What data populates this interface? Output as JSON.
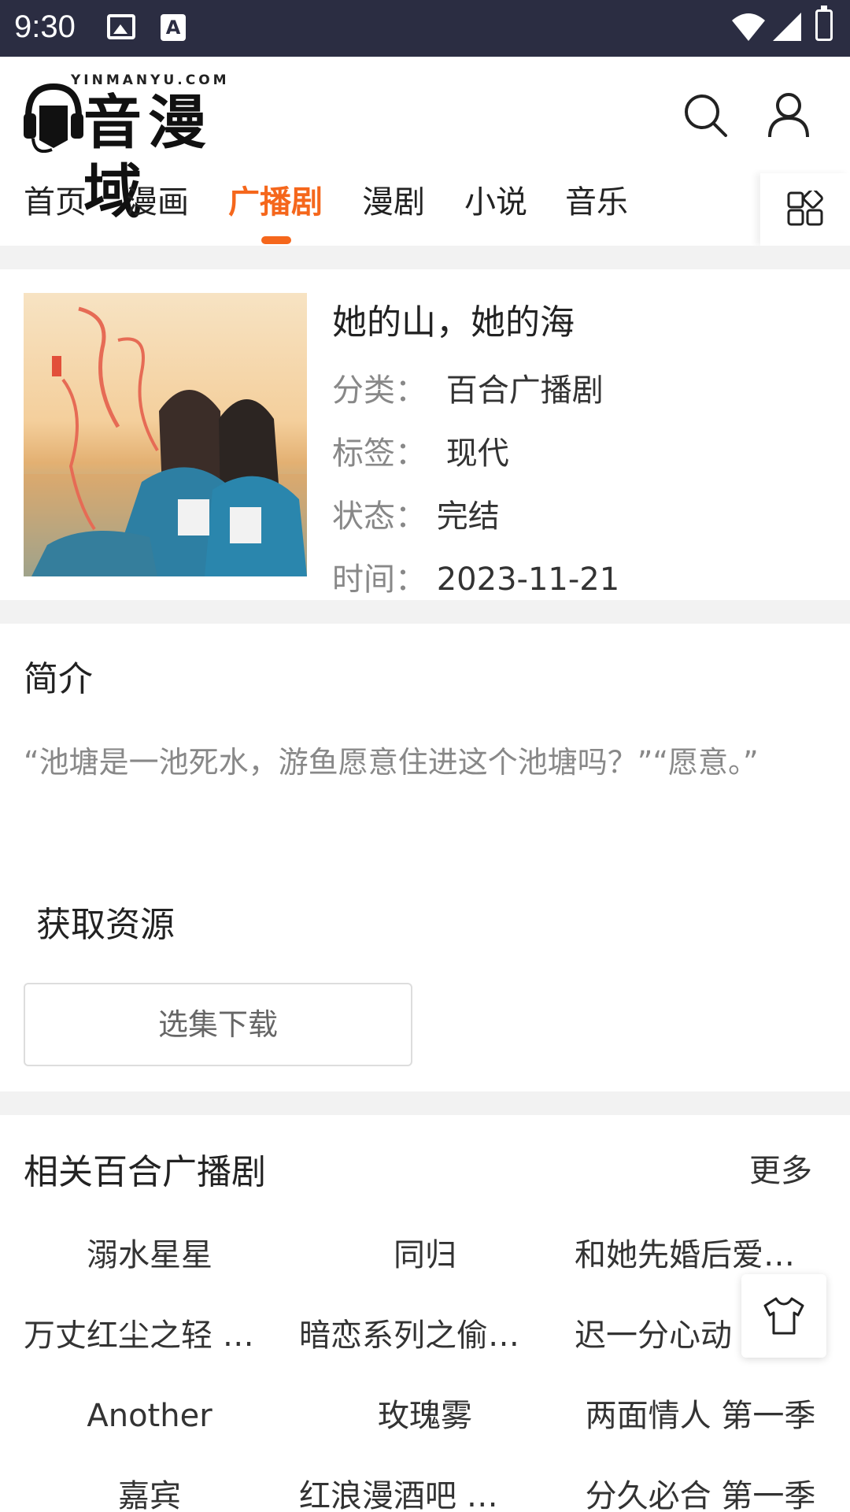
{
  "status_bar": {
    "time": "9:30"
  },
  "header": {
    "logo_site": "YINMANYU.COM",
    "logo_brand": "音漫域",
    "icons": [
      "search-icon",
      "user-icon"
    ]
  },
  "nav": {
    "tabs": [
      {
        "label": "首页"
      },
      {
        "label": "漫画"
      },
      {
        "label": "广播剧",
        "active": true
      },
      {
        "label": "漫剧"
      },
      {
        "label": "小说"
      },
      {
        "label": "音乐"
      }
    ],
    "grid_icon": "grid-menu-icon",
    "accent_color": "#f5671c"
  },
  "drama": {
    "title": "她的山，她的海",
    "category_label": "分类：",
    "category": "百合广播剧",
    "tags_label": "标签：",
    "tags": "现代",
    "status_label": "状态：",
    "status": "完结",
    "time_label": "时间：",
    "time": "2023-11-21"
  },
  "intro": {
    "heading": "简介",
    "description": "“池塘是一池死水，游鱼愿意住进这个池塘吗？”“愿意。”",
    "resource_heading": "获取资源",
    "download_label": "选集下载"
  },
  "related": {
    "heading": "相关百合广播剧",
    "more_label": "更多",
    "items": [
      "溺水星星",
      "同归",
      "和她先婚后爱…",
      "万丈红尘之轻 …",
      "暗恋系列之偷…",
      "迟一分心动",
      "Another",
      "玫瑰雾",
      "两面情人 第一季",
      "嘉宾",
      "红浪漫酒吧 第…",
      "分久必合 第一季"
    ]
  },
  "float_button_icon": "tshirt-icon"
}
